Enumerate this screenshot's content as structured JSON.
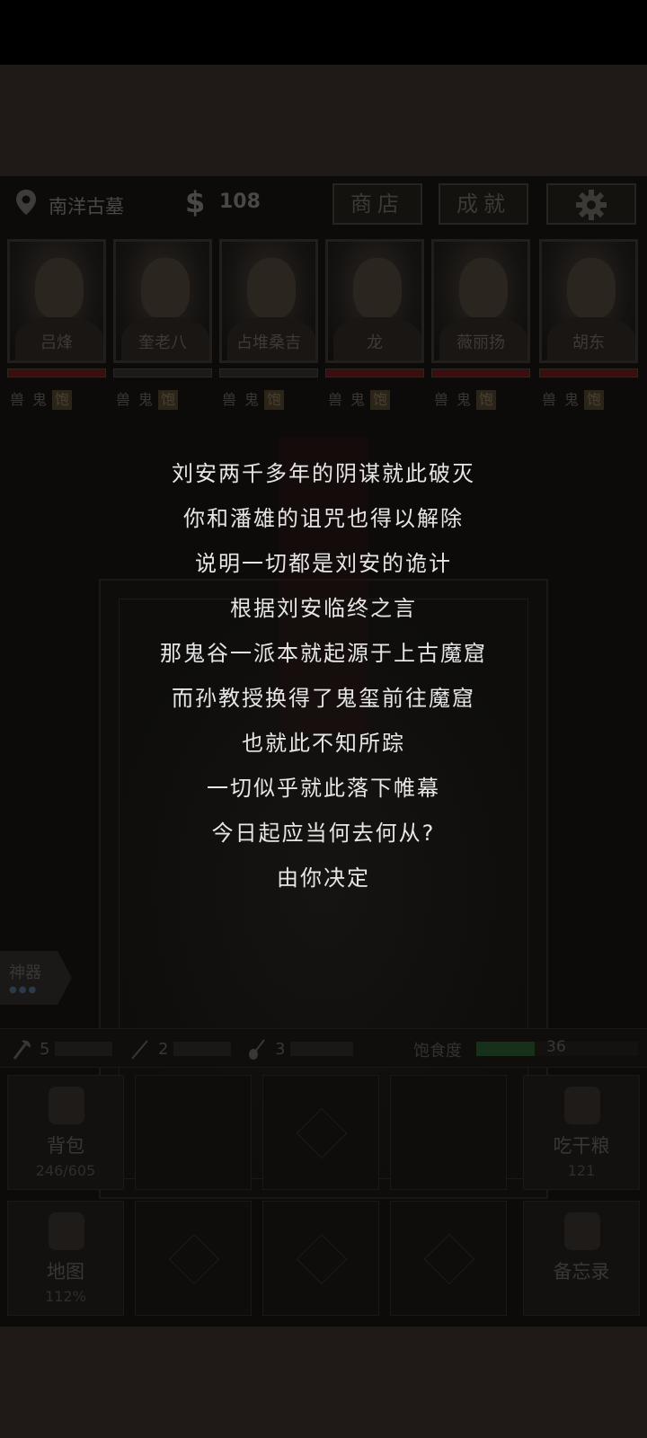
{
  "location": {
    "name": "南洋古墓"
  },
  "money": {
    "symbol": "$",
    "value": "108"
  },
  "buttons": {
    "shop": "商店",
    "achievements": "成就"
  },
  "characters": [
    {
      "name": "吕烽",
      "hp_color": "#3a0e0e"
    },
    {
      "name": "奎老八",
      "hp_color": "#1c1a18"
    },
    {
      "name": "占堆桑吉",
      "hp_color": "#1c1a18"
    },
    {
      "name": "龙",
      "hp_color": "#3a0e0e"
    },
    {
      "name": "薇丽扬",
      "hp_color": "#3a0e0e"
    },
    {
      "name": "胡东",
      "hp_color": "#3a0e0e"
    }
  ],
  "status_tags": [
    "兽",
    "鬼",
    "饱"
  ],
  "story_lines": [
    "刘安两千多年的阴谋就此破灭",
    "你和潘雄的诅咒也得以解除",
    "说明一切都是刘安的诡计",
    "根据刘安临终之言",
    "那鬼谷一派本就起源于上古魔窟",
    "而孙教授换得了鬼玺前往魔窟",
    "也就此不知所踪",
    "一切似乎就此落下帷幕",
    "今日起应当何去何从?",
    "由你决定"
  ],
  "artifact_tab": {
    "label": "神器"
  },
  "tools": [
    {
      "icon": "axe-icon",
      "count": "5"
    },
    {
      "icon": "pickaxe-icon",
      "count": "2"
    },
    {
      "icon": "shovel-icon",
      "count": "3"
    }
  ],
  "hunger": {
    "label": "饱食度",
    "value": "36",
    "fraction": 0.36
  },
  "grid": {
    "backpack": {
      "label": "背包",
      "sub": "246/605"
    },
    "eat": {
      "label": "吃干粮",
      "sub": "121"
    },
    "map": {
      "label": "地图",
      "sub": "112%"
    },
    "memo": {
      "label": "备忘录"
    }
  }
}
